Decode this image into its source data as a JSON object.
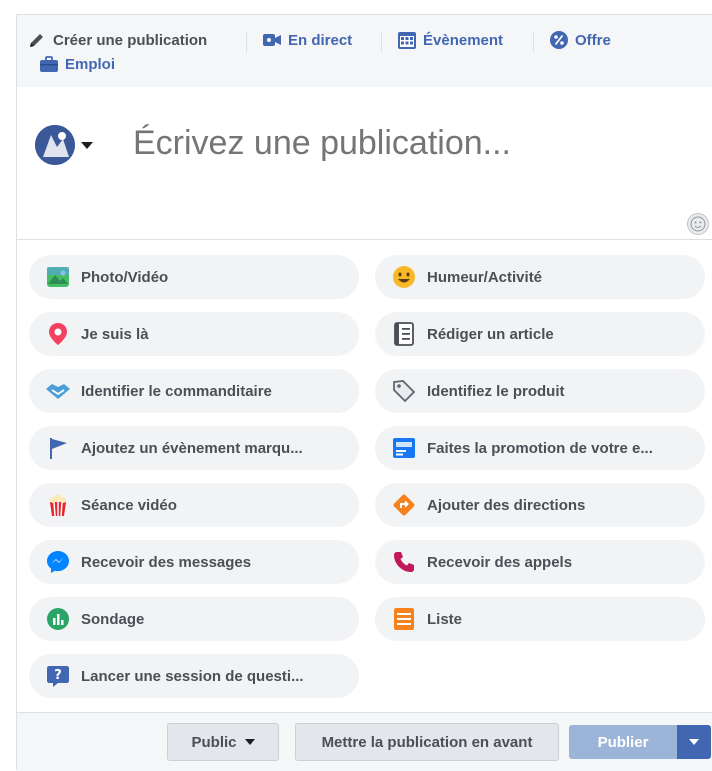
{
  "header_tabs": [
    {
      "label": "Créer une publication",
      "icon": "pencil-icon"
    },
    {
      "label": "En direct",
      "icon": "video-camera-icon"
    },
    {
      "label": "Évènement",
      "icon": "calendar-icon"
    },
    {
      "label": "Offre",
      "icon": "percent-icon"
    },
    {
      "label": "Emploi",
      "icon": "briefcase-icon"
    }
  ],
  "composer": {
    "placeholder": "Écrivez une publication...",
    "avatar_icon": "page-avatar-icon",
    "emoji_icon": "emoji-icon"
  },
  "actions": [
    {
      "label": "Photo/Vidéo",
      "icon": "photo-icon"
    },
    {
      "label": "Humeur/Activité",
      "icon": "smiley-icon"
    },
    {
      "label": "Je suis là",
      "icon": "location-pin-icon"
    },
    {
      "label": "Rédiger un article",
      "icon": "article-icon"
    },
    {
      "label": "Identifier le commanditaire",
      "icon": "handshake-icon"
    },
    {
      "label": "Identifiez le produit",
      "icon": "tag-icon"
    },
    {
      "label": "Ajoutez un évènement marqu...",
      "icon": "flag-icon"
    },
    {
      "label": "Faites la promotion de votre e...",
      "icon": "promotion-icon"
    },
    {
      "label": "Séance vidéo",
      "icon": "popcorn-icon"
    },
    {
      "label": "Ajouter des directions",
      "icon": "directions-icon"
    },
    {
      "label": "Recevoir des messages",
      "icon": "messenger-icon"
    },
    {
      "label": "Recevoir des appels",
      "icon": "phone-icon"
    },
    {
      "label": "Sondage",
      "icon": "poll-icon"
    },
    {
      "label": "Liste",
      "icon": "list-icon"
    },
    {
      "label": "Lancer une session de questi...",
      "icon": "question-icon"
    }
  ],
  "footer": {
    "audience_label": "Public",
    "boost_label": "Mettre la publication en avant",
    "publish_label": "Publier"
  },
  "colors": {
    "brand_blue": "#4267b2",
    "publish_disabled": "#9cb4d8",
    "action_bg": "#f2f3f5"
  }
}
